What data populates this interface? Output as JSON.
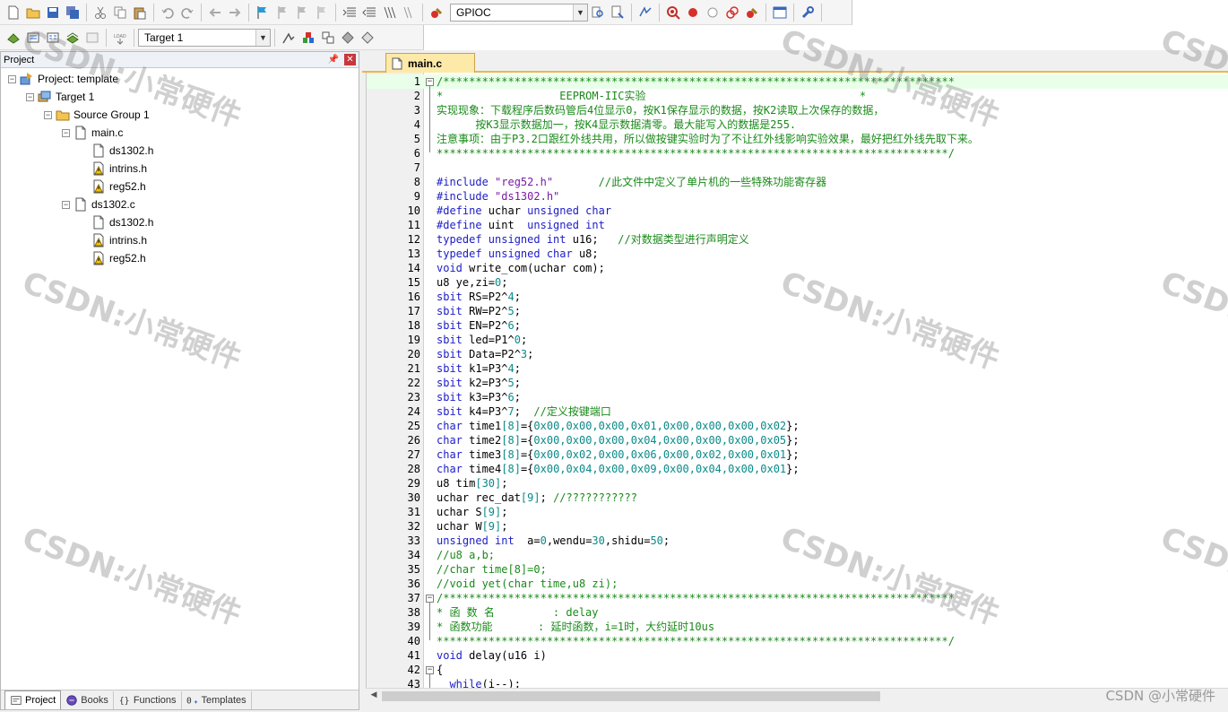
{
  "toolbar1": {
    "target_combo": "GPIOC",
    "icons": [
      "new-file-icon",
      "open-icon",
      "save-icon",
      "save-all-icon",
      "cut-icon",
      "copy-icon",
      "paste-icon",
      "undo-icon",
      "redo-icon",
      "nav-back-icon",
      "nav-forward-icon",
      "bookmark-icon",
      "prev-bookmark-icon",
      "next-bookmark-icon",
      "clear-bookmarks-icon",
      "indent-icon",
      "unindent-icon",
      "comment-icon",
      "uncomment-icon",
      "find-in-files-icon",
      "find-icon",
      "incremental-find-icon",
      "debug-icon",
      "breakpoint-icon",
      "disable-breakpoint-icon",
      "kill-breakpoints-icon",
      "kill-all-icon",
      "window-layout-icon",
      "configure-icon"
    ]
  },
  "toolbar2": {
    "target_combo": "Target 1",
    "icons": [
      "translate-icon",
      "build-icon",
      "rebuild-icon",
      "batch-build-icon",
      "stop-build-icon",
      "download-icon",
      "target-options-icon",
      "manage-components-icon",
      "file-extensions-icon",
      "select-packs-icon",
      "pack-installer-icon"
    ]
  },
  "project_panel": {
    "title": "Project",
    "tree": [
      {
        "label": "Project: template",
        "level": 0,
        "icon": "project-icon",
        "expanded": true
      },
      {
        "label": "Target 1",
        "level": 1,
        "icon": "target-icon",
        "expanded": true
      },
      {
        "label": "Source Group 1",
        "level": 2,
        "icon": "folder-icon",
        "expanded": true
      },
      {
        "label": "main.c",
        "level": 3,
        "icon": "c-file-icon",
        "expanded": true
      },
      {
        "label": "ds1302.h",
        "level": 4,
        "icon": "header-file-icon"
      },
      {
        "label": "intrins.h",
        "level": 4,
        "icon": "header-warning-icon"
      },
      {
        "label": "reg52.h",
        "level": 4,
        "icon": "header-warning-icon"
      },
      {
        "label": "ds1302.c",
        "level": 3,
        "icon": "c-file-icon",
        "expanded": true
      },
      {
        "label": "ds1302.h",
        "level": 4,
        "icon": "header-file-icon"
      },
      {
        "label": "intrins.h",
        "level": 4,
        "icon": "header-warning-icon"
      },
      {
        "label": "reg52.h",
        "level": 4,
        "icon": "header-warning-icon"
      }
    ],
    "tabs": [
      {
        "label": "Project",
        "icon": "project-tab-icon",
        "active": true
      },
      {
        "label": "Books",
        "icon": "books-icon",
        "active": false
      },
      {
        "label": "Functions",
        "icon": "functions-icon",
        "active": false
      },
      {
        "label": "Templates",
        "icon": "templates-icon",
        "active": false
      }
    ]
  },
  "editor": {
    "active_file": "main.c",
    "lines": [
      {
        "n": "1",
        "fold": "-",
        "hl": true,
        "segs": [
          [
            "cm",
            "/*******************************************************************************"
          ]
        ]
      },
      {
        "n": "2",
        "segs": [
          [
            "cm",
            "*                  EEPROM-IIC实验                                 *"
          ]
        ]
      },
      {
        "n": "3",
        "segs": [
          [
            "cm",
            "实现现象：下载程序后数码管后4位显示0，按K1保存显示的数据，按K2读取上次保存的数据，"
          ]
        ]
      },
      {
        "n": "4",
        "segs": [
          [
            "cm",
            "      按K3显示数据加一，按K4显示数据清零。最大能写入的数据是255."
          ]
        ]
      },
      {
        "n": "5",
        "segs": [
          [
            "cm",
            "注意事项：由于P3.2口跟红外线共用，所以做按键实验时为了不让红外线影响实验效果，最好把红外线先取下来。"
          ]
        ]
      },
      {
        "n": "6",
        "segs": [
          [
            "cm",
            "*******************************************************************************/"
          ]
        ]
      },
      {
        "n": "7",
        "segs": []
      },
      {
        "n": "8",
        "segs": [
          [
            "pp",
            "#include "
          ],
          [
            "str",
            "\"reg52.h\""
          ],
          [
            "tx",
            "       "
          ],
          [
            "cm",
            "//此文件中定义了单片机的一些特殊功能寄存器"
          ]
        ]
      },
      {
        "n": "9",
        "segs": [
          [
            "pp",
            "#include "
          ],
          [
            "str",
            "\"ds1302.h\""
          ]
        ]
      },
      {
        "n": "10",
        "segs": [
          [
            "pp",
            "#define "
          ],
          [
            "tx",
            "uchar "
          ],
          [
            "kw",
            "unsigned char"
          ]
        ]
      },
      {
        "n": "11",
        "segs": [
          [
            "pp",
            "#define "
          ],
          [
            "tx",
            "uint  "
          ],
          [
            "kw",
            "unsigned int"
          ]
        ]
      },
      {
        "n": "12",
        "segs": [
          [
            "kw",
            "typedef unsigned int "
          ],
          [
            "tx",
            "u16;   "
          ],
          [
            "cm",
            "//对数据类型进行声明定义"
          ]
        ]
      },
      {
        "n": "13",
        "segs": [
          [
            "kw",
            "typedef unsigned char "
          ],
          [
            "tx",
            "u8;"
          ]
        ]
      },
      {
        "n": "14",
        "segs": [
          [
            "kw",
            "void "
          ],
          [
            "tx",
            "write_com(uchar com);"
          ]
        ]
      },
      {
        "n": "15",
        "segs": [
          [
            "tx",
            "u8 ye,zi="
          ],
          [
            "num",
            "0"
          ],
          [
            "tx",
            ";"
          ]
        ]
      },
      {
        "n": "16",
        "segs": [
          [
            "kw",
            "sbit "
          ],
          [
            "tx",
            "RS=P2^"
          ],
          [
            "num",
            "4"
          ],
          [
            "tx",
            ";"
          ]
        ]
      },
      {
        "n": "17",
        "segs": [
          [
            "kw",
            "sbit "
          ],
          [
            "tx",
            "RW=P2^"
          ],
          [
            "num",
            "5"
          ],
          [
            "tx",
            ";"
          ]
        ]
      },
      {
        "n": "18",
        "segs": [
          [
            "kw",
            "sbit "
          ],
          [
            "tx",
            "EN=P2^"
          ],
          [
            "num",
            "6"
          ],
          [
            "tx",
            ";"
          ]
        ]
      },
      {
        "n": "19",
        "segs": [
          [
            "kw",
            "sbit "
          ],
          [
            "tx",
            "led=P1^"
          ],
          [
            "num",
            "0"
          ],
          [
            "tx",
            ";"
          ]
        ]
      },
      {
        "n": "20",
        "segs": [
          [
            "kw",
            "sbit "
          ],
          [
            "tx",
            "Data=P2^"
          ],
          [
            "num",
            "3"
          ],
          [
            "tx",
            ";"
          ]
        ]
      },
      {
        "n": "21",
        "segs": [
          [
            "kw",
            "sbit "
          ],
          [
            "tx",
            "k1=P3^"
          ],
          [
            "num",
            "4"
          ],
          [
            "tx",
            ";"
          ]
        ]
      },
      {
        "n": "22",
        "segs": [
          [
            "kw",
            "sbit "
          ],
          [
            "tx",
            "k2=P3^"
          ],
          [
            "num",
            "5"
          ],
          [
            "tx",
            ";"
          ]
        ]
      },
      {
        "n": "23",
        "segs": [
          [
            "kw",
            "sbit "
          ],
          [
            "tx",
            "k3=P3^"
          ],
          [
            "num",
            "6"
          ],
          [
            "tx",
            ";"
          ]
        ]
      },
      {
        "n": "24",
        "segs": [
          [
            "kw",
            "sbit "
          ],
          [
            "tx",
            "k4=P3^"
          ],
          [
            "num",
            "7"
          ],
          [
            "tx",
            ";  "
          ],
          [
            "cm",
            "//定义按键端口"
          ]
        ]
      },
      {
        "n": "25",
        "segs": [
          [
            "kw",
            "char "
          ],
          [
            "tx",
            "time1"
          ],
          [
            "br",
            "[8]"
          ],
          [
            "tx",
            "={"
          ],
          [
            "num",
            "0x00,0x00,0x00,0x01,0x00,0x00,0x00,0x02"
          ],
          [
            "tx",
            "};"
          ]
        ]
      },
      {
        "n": "26",
        "segs": [
          [
            "kw",
            "char "
          ],
          [
            "tx",
            "time2"
          ],
          [
            "br",
            "[8]"
          ],
          [
            "tx",
            "={"
          ],
          [
            "num",
            "0x00,0x00,0x00,0x04,0x00,0x00,0x00,0x05"
          ],
          [
            "tx",
            "};"
          ]
        ]
      },
      {
        "n": "27",
        "segs": [
          [
            "kw",
            "char "
          ],
          [
            "tx",
            "time3"
          ],
          [
            "br",
            "[8]"
          ],
          [
            "tx",
            "={"
          ],
          [
            "num",
            "0x00,0x02,0x00,0x06,0x00,0x02,0x00,0x01"
          ],
          [
            "tx",
            "};"
          ]
        ]
      },
      {
        "n": "28",
        "segs": [
          [
            "kw",
            "char "
          ],
          [
            "tx",
            "time4"
          ],
          [
            "br",
            "[8]"
          ],
          [
            "tx",
            "={"
          ],
          [
            "num",
            "0x00,0x04,0x00,0x09,0x00,0x04,0x00,0x01"
          ],
          [
            "tx",
            "};"
          ]
        ]
      },
      {
        "n": "29",
        "segs": [
          [
            "tx",
            "u8 tim"
          ],
          [
            "br",
            "[30]"
          ],
          [
            "tx",
            ";"
          ]
        ]
      },
      {
        "n": "30",
        "segs": [
          [
            "tx",
            "uchar rec_dat"
          ],
          [
            "br",
            "[9]"
          ],
          [
            "tx",
            "; "
          ],
          [
            "cm",
            "//???????????"
          ]
        ]
      },
      {
        "n": "31",
        "segs": [
          [
            "tx",
            "uchar S"
          ],
          [
            "br",
            "[9]"
          ],
          [
            "tx",
            ";"
          ]
        ]
      },
      {
        "n": "32",
        "segs": [
          [
            "tx",
            "uchar W"
          ],
          [
            "br",
            "[9]"
          ],
          [
            "tx",
            ";"
          ]
        ]
      },
      {
        "n": "33",
        "segs": [
          [
            "kw",
            "unsigned int  "
          ],
          [
            "tx",
            "a="
          ],
          [
            "num",
            "0"
          ],
          [
            "tx",
            ",wendu="
          ],
          [
            "num",
            "30"
          ],
          [
            "tx",
            ",shidu="
          ],
          [
            "num",
            "50"
          ],
          [
            "tx",
            ";"
          ]
        ]
      },
      {
        "n": "34",
        "segs": [
          [
            "cm",
            "//u8 a,b;"
          ]
        ]
      },
      {
        "n": "35",
        "segs": [
          [
            "cm",
            "//char time[8]=0;"
          ]
        ]
      },
      {
        "n": "36",
        "segs": [
          [
            "cm",
            "//void yet(char time,u8 zi);"
          ]
        ]
      },
      {
        "n": "37",
        "fold": "-",
        "segs": [
          [
            "cm",
            "/*******************************************************************************"
          ]
        ]
      },
      {
        "n": "38",
        "segs": [
          [
            "cm",
            "* 函 数 名         : delay"
          ]
        ]
      },
      {
        "n": "39",
        "segs": [
          [
            "cm",
            "* 函数功能       : 延时函数，i=1时，大约延时10us"
          ]
        ]
      },
      {
        "n": "40",
        "segs": [
          [
            "cm",
            "*******************************************************************************/"
          ]
        ]
      },
      {
        "n": "41",
        "segs": [
          [
            "kw",
            "void "
          ],
          [
            "tx",
            "delay(u16 i)"
          ]
        ]
      },
      {
        "n": "42",
        "fold": "-",
        "segs": [
          [
            "tx",
            "{"
          ]
        ]
      },
      {
        "n": "43",
        "segs": [
          [
            "tx",
            "  "
          ],
          [
            "kw",
            "while"
          ],
          [
            "tx",
            "(i--);"
          ]
        ]
      }
    ]
  },
  "watermark": "CSDN:小常硬件",
  "footer_mark": "CSDN @小常硬件"
}
